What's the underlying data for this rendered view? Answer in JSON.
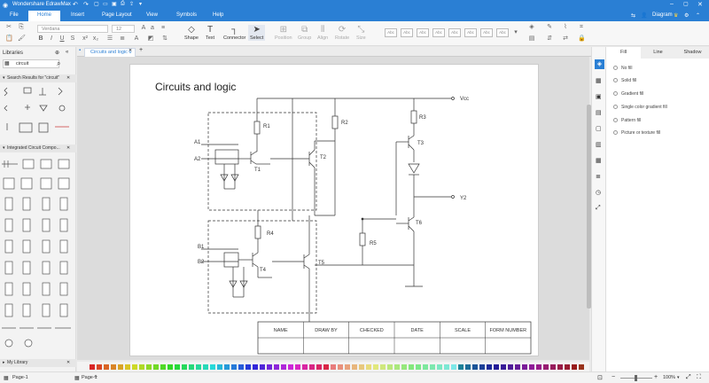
{
  "app": {
    "title": "Wondershare EdrawMax"
  },
  "menu": {
    "file": "File",
    "home": "Home",
    "insert": "Insert",
    "page_layout": "Page Layout",
    "view": "View",
    "symbols": "Symbols",
    "help": "Help",
    "diagram": "Diagram"
  },
  "ribbon": {
    "font_name": "Verdana",
    "font_size": "12",
    "shape": "Shape",
    "text": "Text",
    "connector": "Connector",
    "select": "Select",
    "position": "Position",
    "group": "Group",
    "align": "Align",
    "rotate": "Rotate",
    "size": "Size",
    "style_label": "Abc"
  },
  "library": {
    "header": "Libraries",
    "search_value": "circuit",
    "search_results": "Search Results for \"circuit\"",
    "integrated": "Integrated Circuit Compo...",
    "my_library": "My Library"
  },
  "tab": {
    "name": "Circuits and logic 6"
  },
  "diagram": {
    "title": "Circuits and logic",
    "labels": {
      "vcc": "Vcc",
      "y2": "Y2",
      "a1": "A1",
      "a2": "A2",
      "b1": "B1",
      "b2": "B2",
      "r1": "R1",
      "r2": "R2",
      "r3": "R3",
      "r4": "R4",
      "r5": "R5",
      "t1": "T1",
      "t2": "T2",
      "t3": "T3",
      "t4": "T4",
      "t5": "T5",
      "t6": "T6"
    },
    "table_headers": [
      "NAME",
      "DRAW BY",
      "CHECKED",
      "DATE",
      "SCALE",
      "FORM NUMBER"
    ]
  },
  "panel": {
    "tabs": {
      "fill": "Fill",
      "line": "Line",
      "shadow": "Shadow"
    },
    "options": [
      "No fill",
      "Solid fill",
      "Gradient fill",
      "Single color gradient fill",
      "Pattern fill",
      "Picture or texture fill"
    ]
  },
  "status": {
    "page": "Page-1",
    "page_tab": "Page-1",
    "zoom": "100%"
  },
  "colors": {
    "accent": "#2a7fd4"
  }
}
